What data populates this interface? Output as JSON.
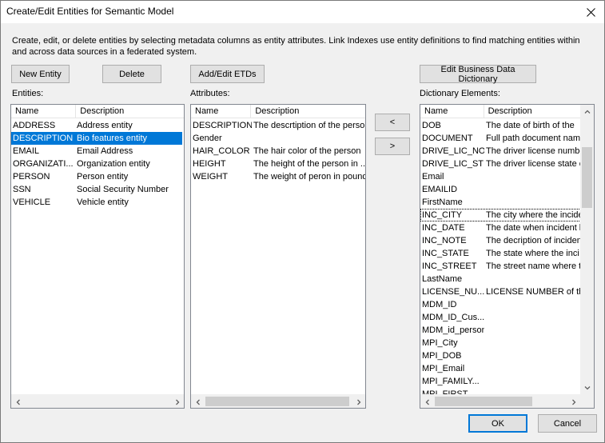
{
  "window": {
    "title": "Create/Edit Entities for Semantic Model"
  },
  "instructions": "Create, edit, or delete entities by selecting metadata columns as entity attributes. Link Indexes use entity definitions to find matching entities within and across data sources in a federated system.",
  "buttons": {
    "new_entity": "New Entity",
    "delete": "Delete",
    "add_edit_etds": "Add/Edit ETDs",
    "edit_business_dictionary": "Edit Business Data Dictionary",
    "move_left": "<",
    "move_right": ">",
    "ok": "OK",
    "cancel": "Cancel"
  },
  "entities": {
    "label": "Entities:",
    "columns": [
      "Name",
      "Description"
    ],
    "rows": [
      {
        "name": "ADDRESS",
        "description": "Address entity"
      },
      {
        "name": "DESCRIPTION",
        "description": "Bio features entity"
      },
      {
        "name": "EMAIL",
        "description": "Email Address"
      },
      {
        "name": "ORGANIZATI...",
        "description": "Organization entity"
      },
      {
        "name": "PERSON",
        "description": "Person entity"
      },
      {
        "name": "SSN",
        "description": "Social Security Number"
      },
      {
        "name": "VEHICLE",
        "description": "Vehicle entity"
      }
    ],
    "selected_index": 1
  },
  "attributes": {
    "label": "Attributes:",
    "columns": [
      "Name",
      "Description"
    ],
    "rows": [
      {
        "name": "DESCRIPTION",
        "description": "The descrtiption of the perso"
      },
      {
        "name": "Gender",
        "description": ""
      },
      {
        "name": "HAIR_COLOR",
        "description": "The hair color of the person"
      },
      {
        "name": "HEIGHT",
        "description": "The height of the person in ..."
      },
      {
        "name": "WEIGHT",
        "description": "The weight of peron in pound"
      }
    ]
  },
  "dictionary": {
    "label": "Dictionary Elements:",
    "columns": [
      "Name",
      "Description"
    ],
    "rows": [
      {
        "name": "DOB",
        "description": "The date of birth of the"
      },
      {
        "name": "DOCUMENT",
        "description": "Full path document name"
      },
      {
        "name": "DRIVE_LIC_NO",
        "description": "The driver license numbe"
      },
      {
        "name": "DRIVE_LIC_ST",
        "description": "The driver license state c"
      },
      {
        "name": "Email",
        "description": ""
      },
      {
        "name": "EMAILID",
        "description": ""
      },
      {
        "name": "FirstName",
        "description": ""
      },
      {
        "name": "INC_CITY",
        "description": "The city where the incide"
      },
      {
        "name": "INC_DATE",
        "description": "The date when incident h"
      },
      {
        "name": "INC_NOTE",
        "description": "The decription of inciden"
      },
      {
        "name": "INC_STATE",
        "description": "The state where the inci"
      },
      {
        "name": "INC_STREET",
        "description": "The street name where t"
      },
      {
        "name": "LastName",
        "description": ""
      },
      {
        "name": "LICENSE_NU...",
        "description": "LICENSE NUMBER of the"
      },
      {
        "name": "MDM_ID",
        "description": ""
      },
      {
        "name": "MDM_ID_Cus...",
        "description": ""
      },
      {
        "name": "MDM_id_person",
        "description": ""
      },
      {
        "name": "MPI_City",
        "description": ""
      },
      {
        "name": "MPI_DOB",
        "description": ""
      },
      {
        "name": "MPI_Email",
        "description": ""
      },
      {
        "name": "MPI_FAMILY...",
        "description": ""
      },
      {
        "name": "MPI_FIRST",
        "description": ""
      }
    ],
    "focused_index": 7
  }
}
